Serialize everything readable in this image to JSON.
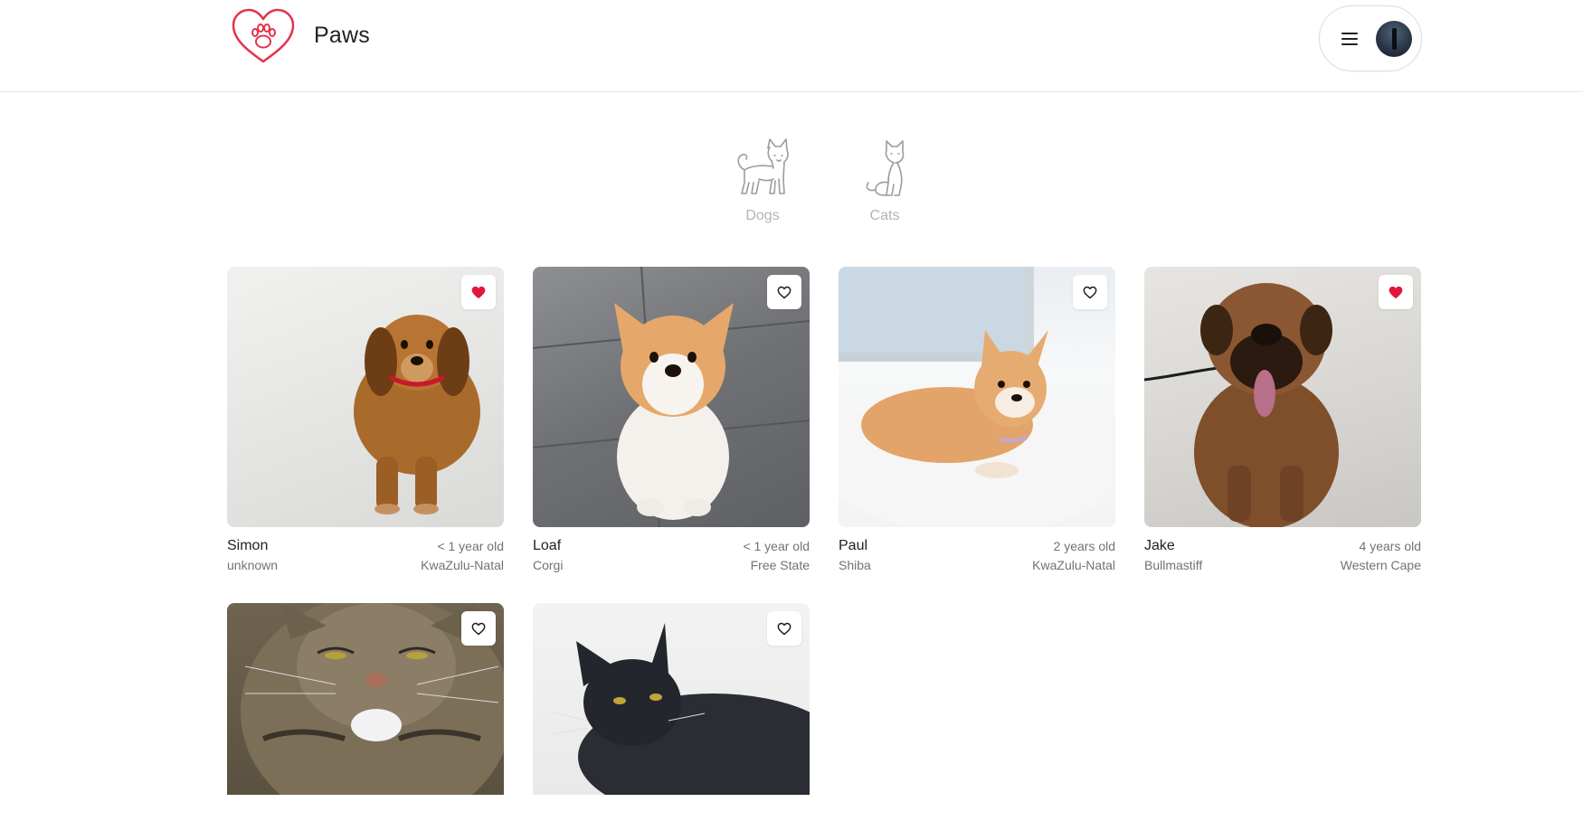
{
  "header": {
    "brand": "Paws",
    "logo_icon": "heart-paw-icon",
    "menu_icon": "hamburger-icon",
    "accent_color": "#e4324a"
  },
  "categories": [
    {
      "label": "Dogs",
      "icon": "dog-icon"
    },
    {
      "label": "Cats",
      "icon": "cat-icon"
    }
  ],
  "pets": [
    {
      "name": "Simon",
      "age": "< 1 year old",
      "breed": "unknown",
      "region": "KwaZulu-Natal",
      "favorited": true
    },
    {
      "name": "Loaf",
      "age": "< 1 year old",
      "breed": "Corgi",
      "region": "Free State",
      "favorited": false
    },
    {
      "name": "Paul",
      "age": "2 years old",
      "breed": "Shiba",
      "region": "KwaZulu-Natal",
      "favorited": false
    },
    {
      "name": "Jake",
      "age": "4 years old",
      "breed": "Bullmastiff",
      "region": "Western Cape",
      "favorited": true
    },
    {
      "favorited": false
    },
    {
      "favorited": false
    }
  ]
}
